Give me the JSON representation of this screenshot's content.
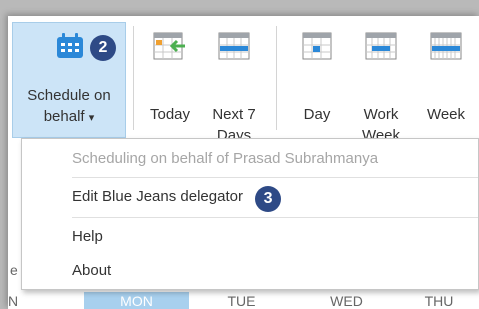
{
  "ribbon": {
    "schedule_on_behalf": {
      "line1": "Schedule on",
      "line2": "behalf",
      "dropdown_glyph": "▾",
      "icon": "calendar-grid-icon",
      "badge": "2"
    },
    "today": {
      "label": "Today",
      "icon": "calendar-today-arrow-icon"
    },
    "next7": {
      "line1": "Next 7",
      "line2": "Days",
      "icon": "calendar-week-icon"
    },
    "day": {
      "label": "Day",
      "icon": "calendar-day-icon"
    },
    "work_week": {
      "line1": "Work",
      "line2": "Week",
      "icon": "calendar-work-week-icon"
    },
    "week": {
      "label": "Week",
      "icon": "calendar-full-week-icon"
    }
  },
  "menu": {
    "items": [
      {
        "label": "Scheduling on behalf of Prasad Subrahmanya",
        "enabled": false
      },
      {
        "label": "Edit Blue Jeans delegator",
        "enabled": true,
        "badge": "3"
      },
      {
        "label": "Help",
        "enabled": true
      },
      {
        "label": "About",
        "enabled": true
      }
    ]
  },
  "calendar_underneath": {
    "left_fragment_top": "e",
    "left_fragment_bottom": "N",
    "days": [
      "MON",
      "TUE",
      "WED",
      "THU"
    ]
  },
  "colors": {
    "accent": "#2b88d8",
    "badge": "#2e4a86",
    "selected_bg": "#cce4f7",
    "green_arrow": "#4caf50"
  }
}
